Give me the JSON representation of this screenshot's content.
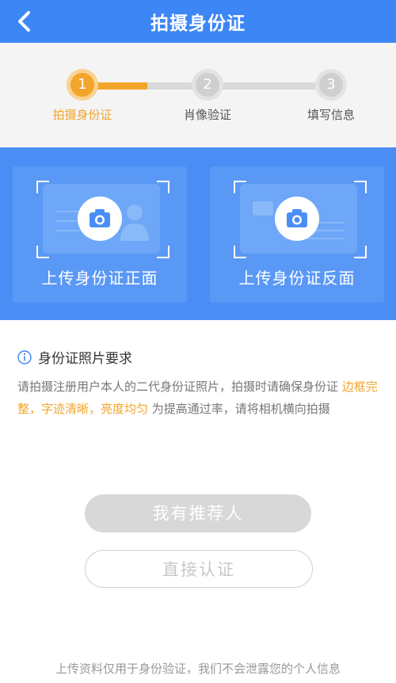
{
  "header": {
    "title": "拍摄身份证",
    "back_icon": "chevron-left-icon"
  },
  "steps": [
    {
      "number": "1",
      "label": "拍摄身份证",
      "state": "active"
    },
    {
      "number": "2",
      "label": "肖像验证",
      "state": "pending"
    },
    {
      "number": "3",
      "label": "填写信息",
      "state": "pending"
    }
  ],
  "upload": {
    "front_label": "上传身份证正面",
    "back_label": "上传身份证反面",
    "icon": "camera-icon"
  },
  "requirements": {
    "title": "身份证照片要求",
    "text_before": "请拍摄注册用户本人的二代身份证照片，拍摄时请确保身份证 ",
    "text_highlight": "边框完整，字迹清晰，亮度均匀",
    "text_after": " 为提高通过率，请将相机横向拍摄"
  },
  "buttons": {
    "referrer": "我有推荐人",
    "direct": "直接认证"
  },
  "footer_note": "上传资料仅用于身份验证，我们不会泄露您的个人信息",
  "colors": {
    "primary": "#3d86f5",
    "accent": "#f2a52a",
    "upload_bg": "#4a8ef5"
  }
}
